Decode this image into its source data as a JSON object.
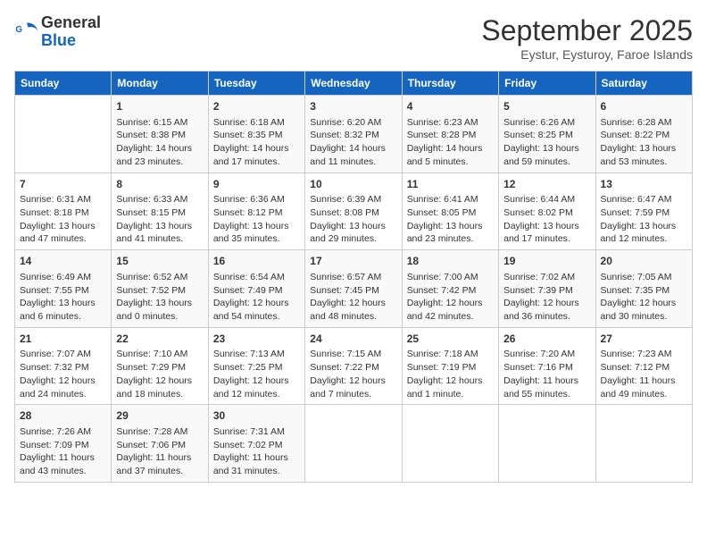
{
  "header": {
    "logo_line1": "General",
    "logo_line2": "Blue",
    "month_title": "September 2025",
    "subtitle": "Eystur, Eysturoy, Faroe Islands"
  },
  "days_of_week": [
    "Sunday",
    "Monday",
    "Tuesday",
    "Wednesday",
    "Thursday",
    "Friday",
    "Saturday"
  ],
  "weeks": [
    [
      {
        "day": "",
        "info": ""
      },
      {
        "day": "1",
        "info": "Sunrise: 6:15 AM\nSunset: 8:38 PM\nDaylight: 14 hours\nand 23 minutes."
      },
      {
        "day": "2",
        "info": "Sunrise: 6:18 AM\nSunset: 8:35 PM\nDaylight: 14 hours\nand 17 minutes."
      },
      {
        "day": "3",
        "info": "Sunrise: 6:20 AM\nSunset: 8:32 PM\nDaylight: 14 hours\nand 11 minutes."
      },
      {
        "day": "4",
        "info": "Sunrise: 6:23 AM\nSunset: 8:28 PM\nDaylight: 14 hours\nand 5 minutes."
      },
      {
        "day": "5",
        "info": "Sunrise: 6:26 AM\nSunset: 8:25 PM\nDaylight: 13 hours\nand 59 minutes."
      },
      {
        "day": "6",
        "info": "Sunrise: 6:28 AM\nSunset: 8:22 PM\nDaylight: 13 hours\nand 53 minutes."
      }
    ],
    [
      {
        "day": "7",
        "info": "Sunrise: 6:31 AM\nSunset: 8:18 PM\nDaylight: 13 hours\nand 47 minutes."
      },
      {
        "day": "8",
        "info": "Sunrise: 6:33 AM\nSunset: 8:15 PM\nDaylight: 13 hours\nand 41 minutes."
      },
      {
        "day": "9",
        "info": "Sunrise: 6:36 AM\nSunset: 8:12 PM\nDaylight: 13 hours\nand 35 minutes."
      },
      {
        "day": "10",
        "info": "Sunrise: 6:39 AM\nSunset: 8:08 PM\nDaylight: 13 hours\nand 29 minutes."
      },
      {
        "day": "11",
        "info": "Sunrise: 6:41 AM\nSunset: 8:05 PM\nDaylight: 13 hours\nand 23 minutes."
      },
      {
        "day": "12",
        "info": "Sunrise: 6:44 AM\nSunset: 8:02 PM\nDaylight: 13 hours\nand 17 minutes."
      },
      {
        "day": "13",
        "info": "Sunrise: 6:47 AM\nSunset: 7:59 PM\nDaylight: 13 hours\nand 12 minutes."
      }
    ],
    [
      {
        "day": "14",
        "info": "Sunrise: 6:49 AM\nSunset: 7:55 PM\nDaylight: 13 hours\nand 6 minutes."
      },
      {
        "day": "15",
        "info": "Sunrise: 6:52 AM\nSunset: 7:52 PM\nDaylight: 13 hours\nand 0 minutes."
      },
      {
        "day": "16",
        "info": "Sunrise: 6:54 AM\nSunset: 7:49 PM\nDaylight: 12 hours\nand 54 minutes."
      },
      {
        "day": "17",
        "info": "Sunrise: 6:57 AM\nSunset: 7:45 PM\nDaylight: 12 hours\nand 48 minutes."
      },
      {
        "day": "18",
        "info": "Sunrise: 7:00 AM\nSunset: 7:42 PM\nDaylight: 12 hours\nand 42 minutes."
      },
      {
        "day": "19",
        "info": "Sunrise: 7:02 AM\nSunset: 7:39 PM\nDaylight: 12 hours\nand 36 minutes."
      },
      {
        "day": "20",
        "info": "Sunrise: 7:05 AM\nSunset: 7:35 PM\nDaylight: 12 hours\nand 30 minutes."
      }
    ],
    [
      {
        "day": "21",
        "info": "Sunrise: 7:07 AM\nSunset: 7:32 PM\nDaylight: 12 hours\nand 24 minutes."
      },
      {
        "day": "22",
        "info": "Sunrise: 7:10 AM\nSunset: 7:29 PM\nDaylight: 12 hours\nand 18 minutes."
      },
      {
        "day": "23",
        "info": "Sunrise: 7:13 AM\nSunset: 7:25 PM\nDaylight: 12 hours\nand 12 minutes."
      },
      {
        "day": "24",
        "info": "Sunrise: 7:15 AM\nSunset: 7:22 PM\nDaylight: 12 hours\nand 7 minutes."
      },
      {
        "day": "25",
        "info": "Sunrise: 7:18 AM\nSunset: 7:19 PM\nDaylight: 12 hours\nand 1 minute."
      },
      {
        "day": "26",
        "info": "Sunrise: 7:20 AM\nSunset: 7:16 PM\nDaylight: 11 hours\nand 55 minutes."
      },
      {
        "day": "27",
        "info": "Sunrise: 7:23 AM\nSunset: 7:12 PM\nDaylight: 11 hours\nand 49 minutes."
      }
    ],
    [
      {
        "day": "28",
        "info": "Sunrise: 7:26 AM\nSunset: 7:09 PM\nDaylight: 11 hours\nand 43 minutes."
      },
      {
        "day": "29",
        "info": "Sunrise: 7:28 AM\nSunset: 7:06 PM\nDaylight: 11 hours\nand 37 minutes."
      },
      {
        "day": "30",
        "info": "Sunrise: 7:31 AM\nSunset: 7:02 PM\nDaylight: 11 hours\nand 31 minutes."
      },
      {
        "day": "",
        "info": ""
      },
      {
        "day": "",
        "info": ""
      },
      {
        "day": "",
        "info": ""
      },
      {
        "day": "",
        "info": ""
      }
    ]
  ]
}
